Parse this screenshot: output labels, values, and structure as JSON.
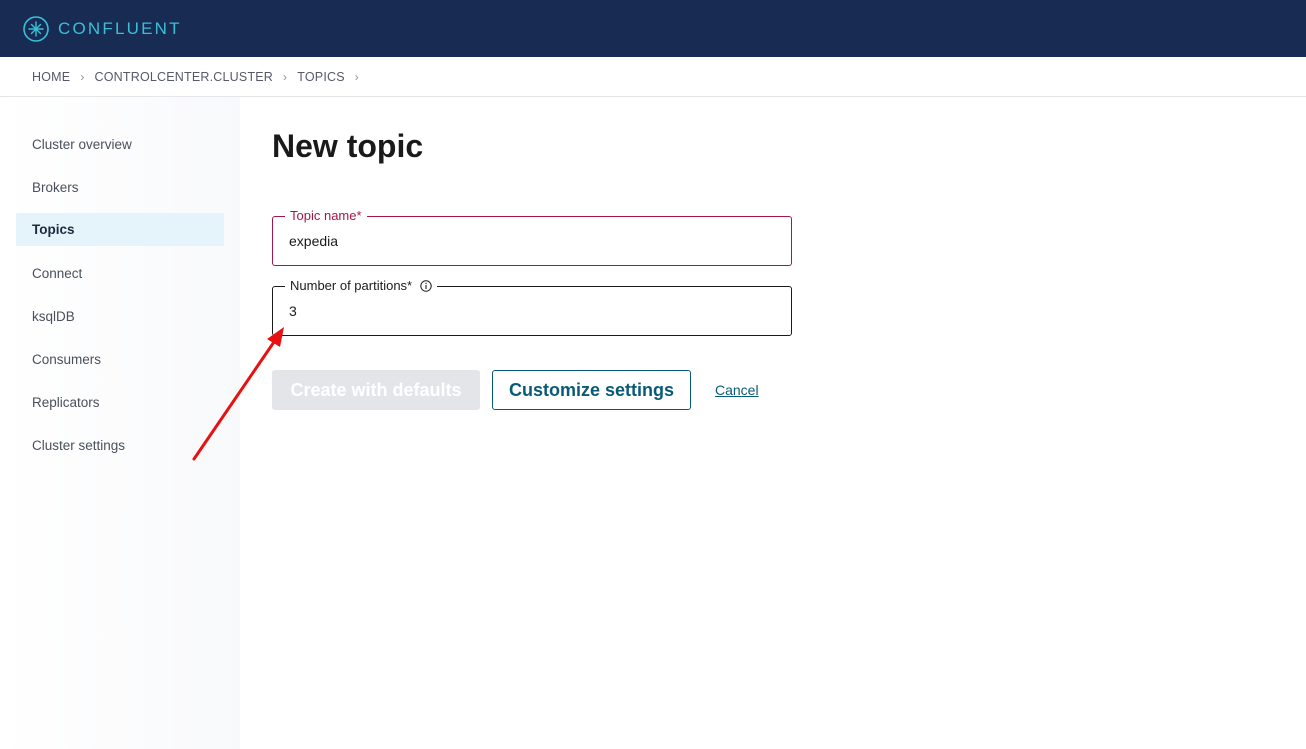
{
  "brand": {
    "name": "CONFLUENT",
    "logo_icon": "confluent-logo-icon",
    "bar_color": "#172b53",
    "accent": "#39c0d8"
  },
  "breadcrumb": {
    "items": [
      "HOME",
      "CONTROLCENTER.CLUSTER",
      "TOPICS"
    ],
    "separator": "›"
  },
  "sidebar": {
    "items": [
      {
        "label": "Cluster overview",
        "active": false
      },
      {
        "label": "Brokers",
        "active": false
      },
      {
        "label": "Topics",
        "active": true
      },
      {
        "label": "Connect",
        "active": false
      },
      {
        "label": "ksqlDB",
        "active": false
      },
      {
        "label": "Consumers",
        "active": false
      },
      {
        "label": "Replicators",
        "active": false
      },
      {
        "label": "Cluster settings",
        "active": false
      }
    ]
  },
  "main": {
    "title": "New topic",
    "topic_name": {
      "label": "Topic name*",
      "value": "expedia",
      "state_color": "#a3164a"
    },
    "partitions": {
      "label": "Number of partitions*",
      "value": "3",
      "icon": "info-icon"
    },
    "buttons": {
      "create_defaults": "Create with defaults",
      "customize": "Customize settings",
      "cancel": "Cancel"
    }
  },
  "annotation": {
    "type": "red-arrow",
    "color": "#e81010"
  }
}
